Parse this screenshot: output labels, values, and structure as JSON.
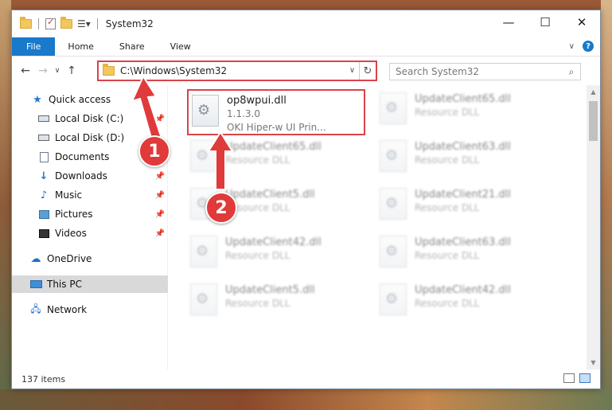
{
  "window": {
    "title": "System32",
    "controls": {
      "minimize": "—",
      "maximize": "☐",
      "close": "✕"
    }
  },
  "ribbon": {
    "tabs": [
      "File",
      "Home",
      "Share",
      "View"
    ],
    "help": "?"
  },
  "address": {
    "path": "C:\\Windows\\System32",
    "search_placeholder": "Search System32"
  },
  "nav": {
    "items": [
      {
        "label": "Quick access",
        "icon": "star-icon",
        "pinned": false
      },
      {
        "label": "Local Disk (C:)",
        "icon": "drive-icon",
        "pinned": true
      },
      {
        "label": "Local Disk (D:)",
        "icon": "drive-icon",
        "pinned": false
      },
      {
        "label": "Documents",
        "icon": "documents-icon",
        "pinned": true
      },
      {
        "label": "Downloads",
        "icon": "download-icon",
        "pinned": true
      },
      {
        "label": "Music",
        "icon": "music-icon",
        "pinned": true
      },
      {
        "label": "Pictures",
        "icon": "pictures-icon",
        "pinned": true
      },
      {
        "label": "Videos",
        "icon": "videos-icon",
        "pinned": true
      },
      {
        "label": "OneDrive",
        "icon": "cloud-icon",
        "pinned": false
      },
      {
        "label": "This PC",
        "icon": "computer-icon",
        "pinned": false,
        "selected": true
      },
      {
        "label": "Network",
        "icon": "network-icon",
        "pinned": false
      }
    ]
  },
  "files": [
    {
      "name": "op8wpui.dll",
      "line2": "1.1.3.0",
      "line3": "OKI Hiper-w UI Prin...",
      "highlighted": true
    },
    {
      "name": "UpdateClient65.dll",
      "line2": "Resource DLL"
    },
    {
      "name": "UpdateClient65.dll",
      "line2": "Resource DLL"
    },
    {
      "name": "UpdateClient63.dll",
      "line2": "Resource DLL"
    },
    {
      "name": "UpdateClient5.dll",
      "line2": "Resource DLL"
    },
    {
      "name": "UpdateClient21.dll",
      "line2": "Resource DLL"
    },
    {
      "name": "UpdateClient42.dll",
      "line2": "Resource DLL"
    },
    {
      "name": "UpdateClient63.dll",
      "line2": "Resource DLL"
    },
    {
      "name": "UpdateClient5.dll",
      "line2": "Resource DLL"
    },
    {
      "name": "UpdateClient42.dll",
      "line2": "Resource DLL"
    }
  ],
  "status": {
    "item_count": "137 items"
  },
  "annotations": {
    "step1": "1",
    "step2": "2",
    "color": "#e03a3a"
  }
}
